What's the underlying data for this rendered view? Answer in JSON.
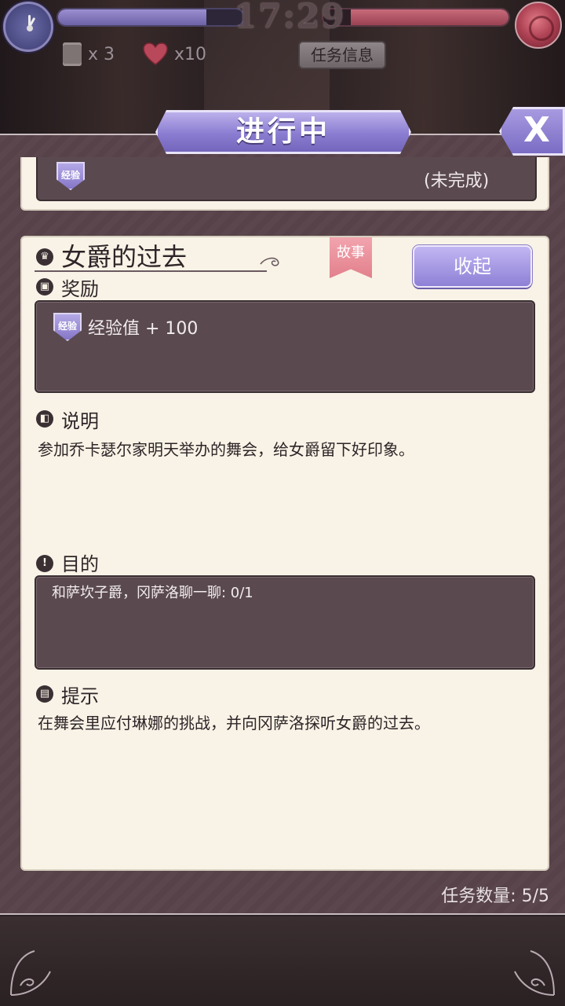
{
  "hud": {
    "time": "17:29",
    "left_bar_fill": 0.8,
    "right_bar_fill": 0.85,
    "scroll_count": "x 3",
    "heart_count": "x10",
    "task_info_label": "任务信息"
  },
  "panel": {
    "title": "进行中",
    "close_label": "X"
  },
  "prev_task": {
    "badge": "经验",
    "status": "(未完成)"
  },
  "quest": {
    "title": "女爵的过去",
    "tag": "故事",
    "collapse_label": "收起",
    "reward_label": "奖励",
    "reward_badge": "经验",
    "reward_text": "经验值 + 100",
    "desc_label": "说明",
    "desc_text": "参加乔卡瑟尔家明天举办的舞会，给女爵留下好印象。",
    "goal_label": "目的",
    "goal_text": "和萨坎子爵，冈萨洛聊一聊: 0/1",
    "hint_label": "提示",
    "hint_text": "在舞会里应付琳娜的挑战，并向冈萨洛探听女爵的过去。"
  },
  "footer": {
    "task_count": "任务数量:  5/5"
  },
  "colors": {
    "accent_purple": "#8a7cd0",
    "card_bg": "#f8f3e6",
    "dark_box": "#5a4a50",
    "story_tag": "#e2808c"
  }
}
